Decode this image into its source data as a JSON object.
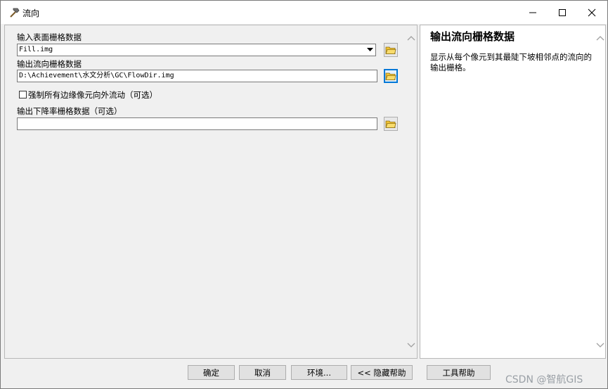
{
  "window": {
    "title": "流向",
    "title_icon": "hammer-tool-icon",
    "controls": {
      "minimize": "minimize-icon",
      "maximize": "maximize-icon",
      "close": "close-icon"
    }
  },
  "form": {
    "input_surface": {
      "label": "输入表面栅格数据",
      "value": "Fill.img"
    },
    "output_direction": {
      "label": "输出流向栅格数据",
      "value": "D:\\Achievement\\水文分析\\GC\\FlowDir.img"
    },
    "force_edge": {
      "label": "强制所有边缘像元向外流动（可选）",
      "checked": false
    },
    "output_drop": {
      "label": "输出下降率栅格数据（可选）",
      "value": ""
    }
  },
  "help": {
    "title": "输出流向栅格数据",
    "body": "显示从每个像元到其最陡下坡相邻点的流向的输出栅格。"
  },
  "buttons": {
    "ok": "确定",
    "cancel": "取消",
    "environments": "环境...",
    "hide_help": "<< 隐藏帮助",
    "tool_help": "工具帮助"
  },
  "watermark": "CSDN @智航GIS",
  "colors": {
    "accent": "#0078d7",
    "folder": "#f2c230"
  }
}
